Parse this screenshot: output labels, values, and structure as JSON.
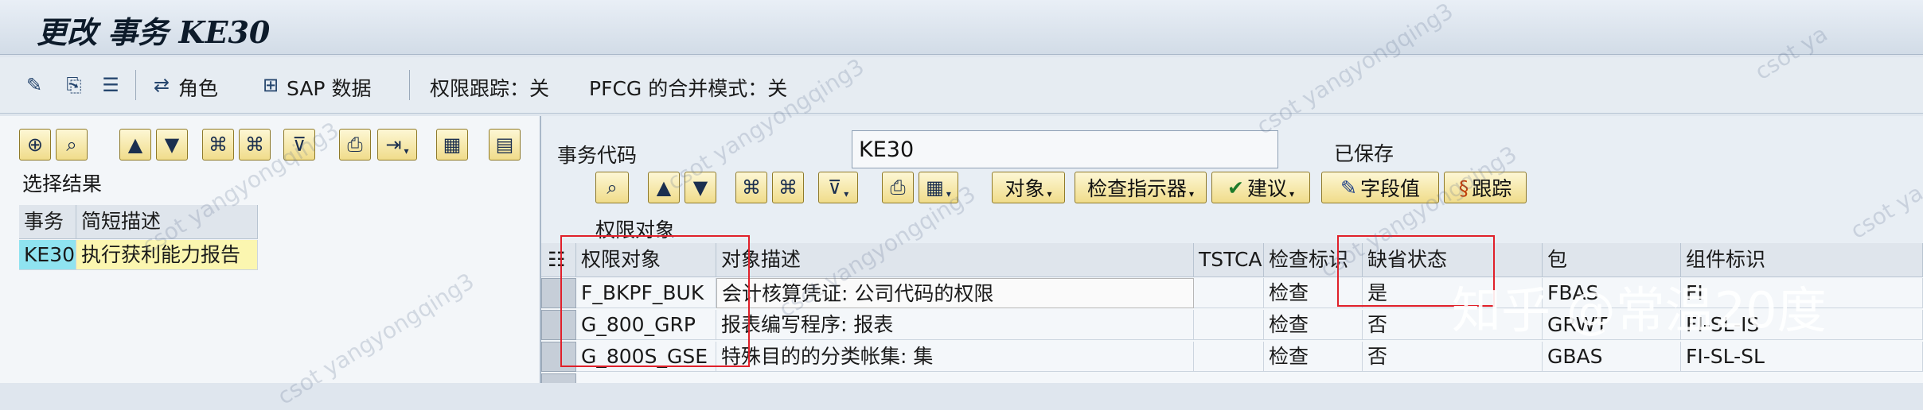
{
  "window": {
    "title": "更改 事务 KE30"
  },
  "app_toolbar": {
    "role_label": "角色",
    "sap_data_label": "SAP 数据",
    "auth_trace_text": "权限跟踪：关",
    "pfcg_merge_text": "PFCG 的合并模式：关"
  },
  "left_panel": {
    "section_title": "选择结果",
    "columns": [
      "事务",
      "简短描述"
    ],
    "rows": [
      {
        "tcode": "KE30",
        "desc": "执行获利能力报告"
      }
    ]
  },
  "right_panel": {
    "tcode_label": "事务代码",
    "tcode_value": "KE30",
    "status_text": "已保存",
    "buttons": {
      "object": "对象",
      "check_indicator": "检查指示器",
      "proposal": "建议",
      "field_values": "字段值",
      "trace": "跟踪"
    },
    "table_title": "权限对象",
    "columns": [
      "权限对象",
      "对象描述",
      "TSTCA",
      "检查标识",
      "缺省状态",
      "包",
      "组件标识"
    ],
    "rows": [
      {
        "object": "F_BKPF_BUK",
        "desc": "会计核算凭证: 公司代码的权限",
        "tstca": "",
        "check": "检查",
        "default": "是",
        "package": "FBAS",
        "component": "FI"
      },
      {
        "object": "G_800_GRP",
        "desc": "报表编写程序: 报表",
        "tstca": "",
        "check": "检查",
        "default": "否",
        "package": "GRWT",
        "component": "FI-SL-IS"
      },
      {
        "object": "G_800S_GSE",
        "desc": "特殊目的的分类帐集: 集",
        "tstca": "",
        "check": "检查",
        "default": "否",
        "package": "GBAS",
        "component": "FI-SL-SL"
      }
    ]
  },
  "watermarks": {
    "text": "csot yangyongqing3",
    "short": "csot ya",
    "brand": "知乎 @常温20度"
  },
  "colors": {
    "accent_red": "#e0202a",
    "button_yellow": "#f0dc8a",
    "header_bg": "#dfe5ec"
  }
}
